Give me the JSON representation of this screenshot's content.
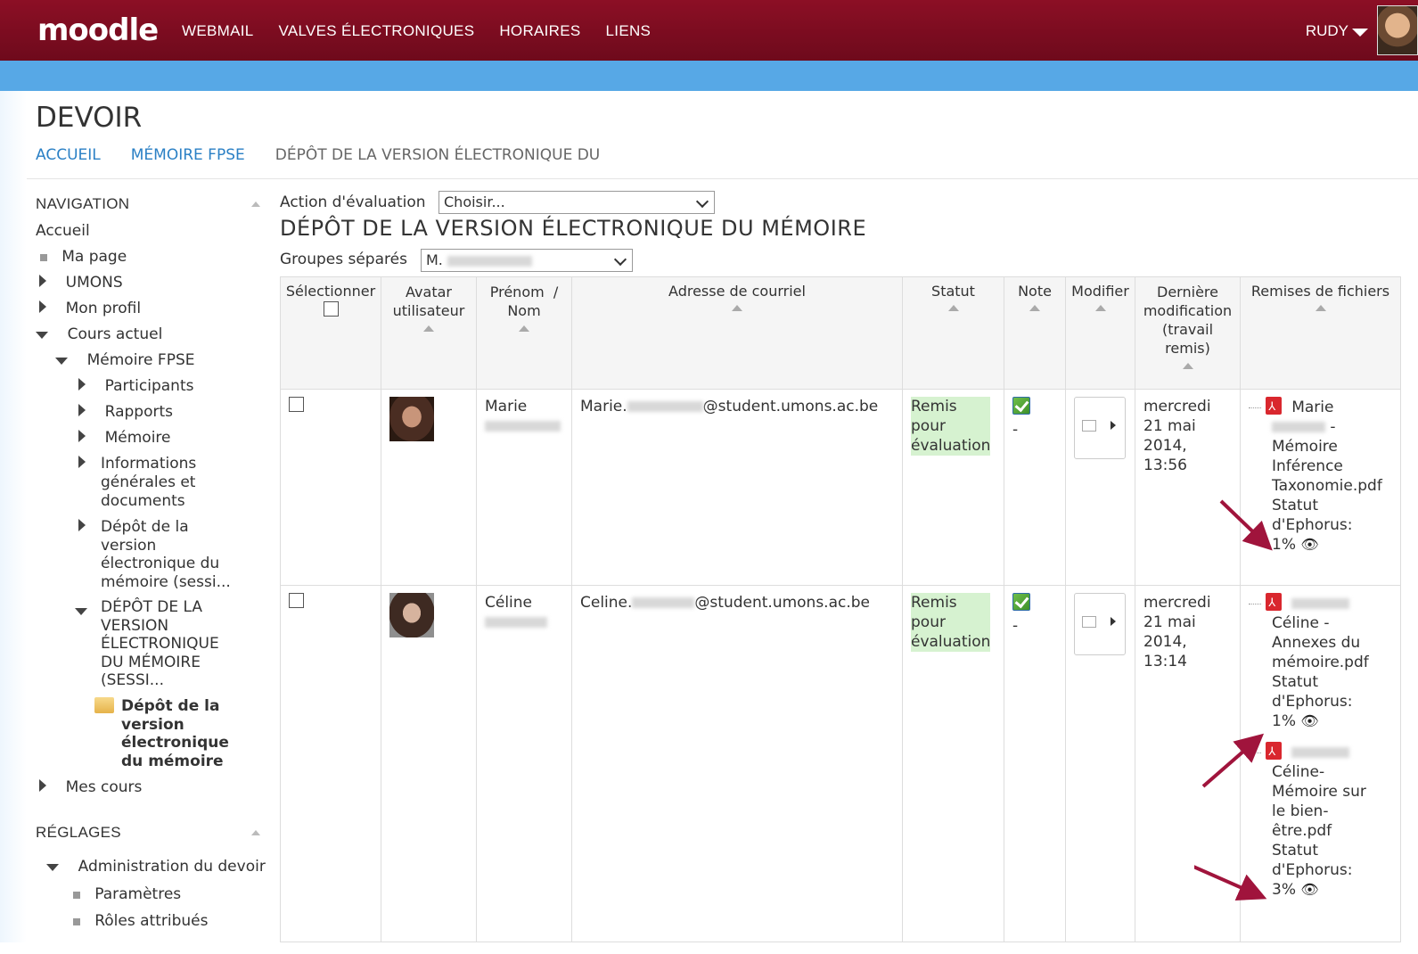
{
  "header": {
    "logo": "moodle",
    "nav": [
      "WEBMAIL",
      "VALVES ÉLECTRONIQUES",
      "HORAIRES",
      "LIENS"
    ],
    "user": "RUDY"
  },
  "page": {
    "title": "DEVOIR",
    "breadcrumb": [
      "ACCUEIL",
      "MÉMOIRE FPSE",
      "DÉPÔT DE LA VERSION ÉLECTRONIQUE DU"
    ]
  },
  "navigation": {
    "title": "NAVIGATION",
    "home": "Accueil",
    "my_page": "Ma page",
    "umons": "UMONS",
    "profile": "Mon profil",
    "current_course": "Cours actuel",
    "course": "Mémoire FPSE",
    "participants": "Participants",
    "reports": "Rapports",
    "memoire": "Mémoire",
    "info": [
      "Informations",
      "générales et",
      "documents"
    ],
    "depot_session": [
      "Dépôt de la",
      "version",
      "électronique du",
      "mémoire (sessi..."
    ],
    "depot_upper": [
      "DÉPÔT DE LA",
      "VERSION",
      "ÉLECTRONIQUE",
      "DU MÉMOIRE",
      "(SESSI..."
    ],
    "active": [
      "Dépôt de la",
      "version",
      "électronique",
      "du mémoire"
    ],
    "my_courses": "Mes cours"
  },
  "settings": {
    "title": "RÉGLAGES",
    "admin": "Administration du devoir",
    "params": "Paramètres",
    "roles": "Rôles attribués"
  },
  "main": {
    "grading_action_label": "Action d'évaluation",
    "grading_action_value": "Choisir...",
    "heading": "DÉPÔT DE LA VERSION ÉLECTRONIQUE DU MÉMOIRE",
    "groups_label": "Groupes séparés",
    "groups_value": "M."
  },
  "table": {
    "headers": {
      "select": "Sélectionner",
      "avatar": [
        "Avatar",
        "utilisateur"
      ],
      "name": [
        "Prénom",
        "/",
        "Nom"
      ],
      "email": "Adresse de courriel",
      "status": "Statut",
      "grade": "Note",
      "edit": "Modifier",
      "lastmod": [
        "Dernière",
        "modification",
        "(travail",
        "remis)"
      ],
      "files": "Remises de fichiers"
    },
    "rows": [
      {
        "firstname": "Marie",
        "email_prefix": "Marie.",
        "email_domain": "@student.umons.ac.be",
        "status": [
          "Remis",
          "pour",
          "évaluation"
        ],
        "grade": "-",
        "date": [
          "mercredi",
          "21 mai",
          "2014,",
          "13:56"
        ],
        "files": [
          {
            "lines_top": "Marie",
            "lines": [
              "-",
              "Mémoire",
              "Inférence",
              "Taxonomie.pdf",
              "Statut",
              "d'Ephorus:"
            ],
            "pct": "1%"
          }
        ]
      },
      {
        "firstname": "Céline",
        "email_prefix": "Celine.",
        "email_domain": "@student.umons.ac.be",
        "status": [
          "Remis",
          "pour",
          "évaluation"
        ],
        "grade": "-",
        "date": [
          "mercredi",
          "21 mai",
          "2014,",
          "13:14"
        ],
        "files": [
          {
            "lines": [
              "Céline -",
              "Annexes du",
              "mémoire.pdf",
              "Statut",
              "d'Ephorus:"
            ],
            "pct": "1%"
          },
          {
            "lines": [
              "Céline-",
              "Mémoire sur",
              "le bien-",
              "être.pdf",
              "Statut",
              "d'Ephorus:"
            ],
            "pct": "3%"
          }
        ]
      }
    ]
  }
}
